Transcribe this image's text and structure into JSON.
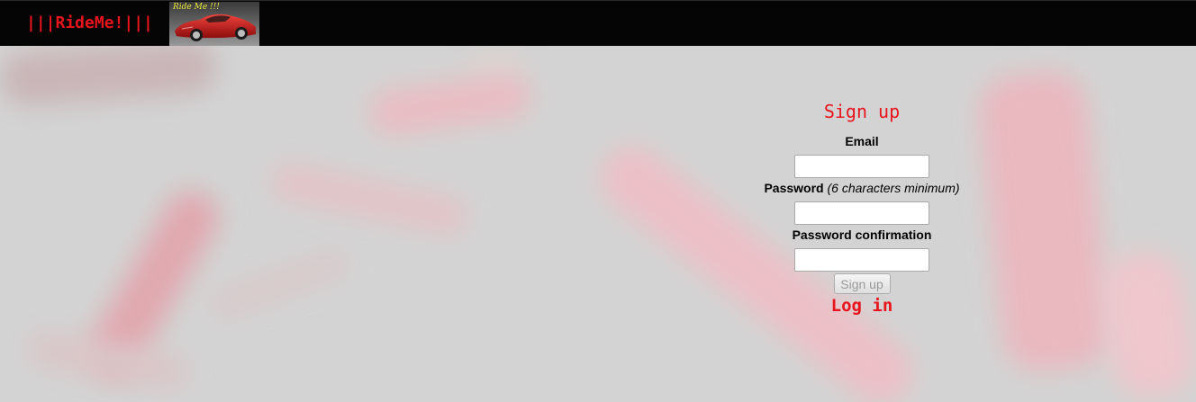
{
  "header": {
    "brand_text": "|||RideMe!|||",
    "logo_text": "Ride Me !!!"
  },
  "signup": {
    "title": "Sign up",
    "email_label": "Email",
    "email_value": "",
    "password_label": "Password",
    "password_hint": "(6 characters minimum)",
    "password_value": "",
    "confirmation_label": "Password confirmation",
    "confirmation_value": "",
    "submit_label": "Sign up",
    "login_link": "Log in"
  },
  "colors": {
    "accent": "#e8141c",
    "topbar": "#050505",
    "background": "#d3d3d3"
  }
}
